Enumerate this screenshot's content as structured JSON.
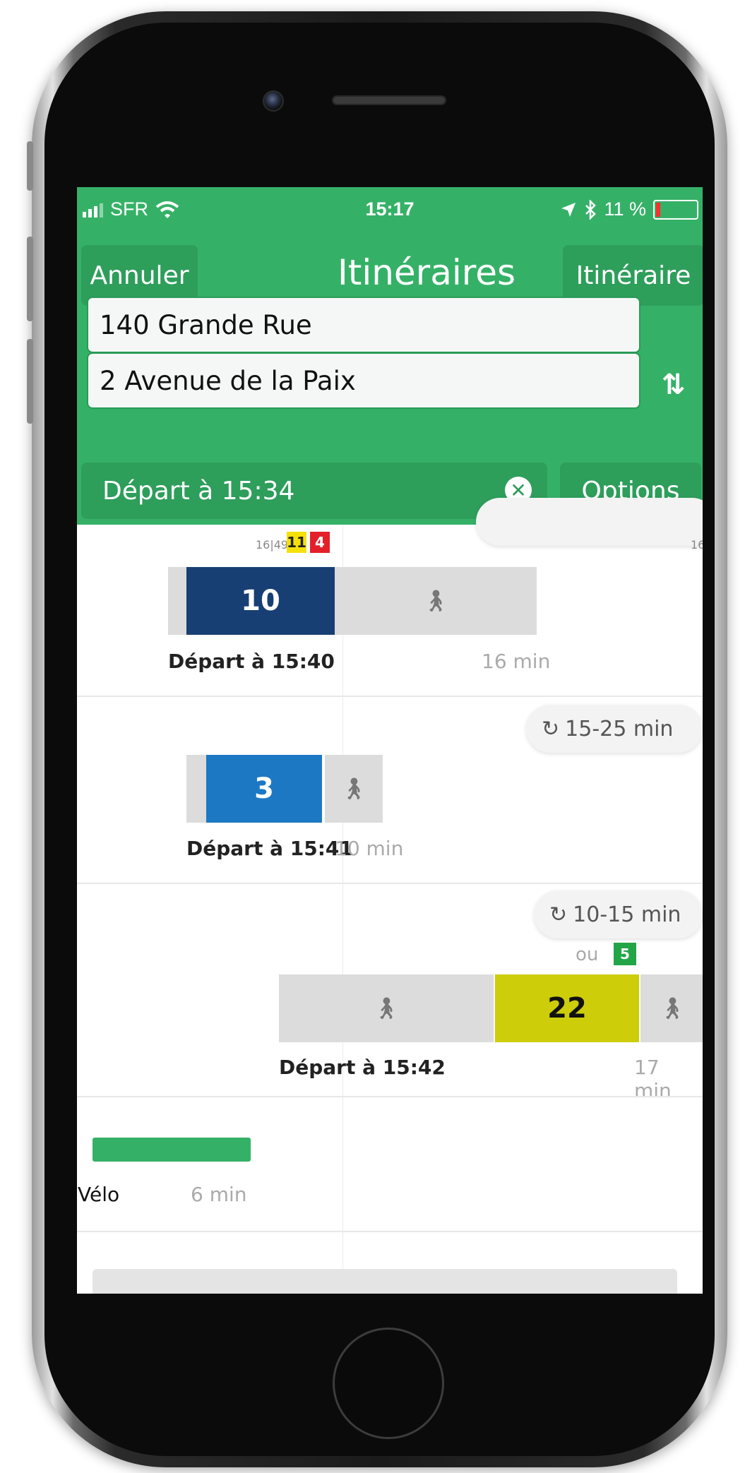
{
  "status_bar": {
    "carrier": "SFR",
    "time": "15:17",
    "battery": "11 %",
    "battery_level": 0.11,
    "icons": [
      "signal-icon",
      "wifi-icon",
      "location-icon",
      "bluetooth-icon",
      "battery-icon"
    ]
  },
  "header": {
    "cancel_label": "Annuler",
    "title": "Itinéraires",
    "itinerary_label": "Itinéraire",
    "from_value": "140 Grande Rue",
    "to_value": "2 Avenue de la Paix",
    "swap_icon": "⇅",
    "depart_label": "Départ à 15:34",
    "options_label": "Options"
  },
  "routes": [
    {
      "partial_top_text": "16|49",
      "badges": [
        "11",
        "4"
      ],
      "right_edge_text": "16",
      "line": "10",
      "depart": "Départ à 15:40",
      "duration": "16 min"
    },
    {
      "frequency": "15-25 min",
      "line": "3",
      "depart": "Départ à 15:41",
      "duration": "10 min"
    },
    {
      "frequency": "10-15 min",
      "alt_label": "ou",
      "alt_line": "5",
      "line": "22",
      "depart": "Départ à 15:42",
      "duration": "17 min"
    },
    {
      "mode": "Vélo",
      "duration": "6 min"
    }
  ],
  "colors": {
    "header_green": "#35b167",
    "button_green": "#2e9e5b",
    "line_10": "#183f73",
    "line_3": "#1d78c4",
    "line_22": "#cdcd0a",
    "line_5": "#22a546",
    "badge_11": "#f5e10a",
    "badge_4": "#e3202a",
    "bike_green": "#35b167"
  }
}
